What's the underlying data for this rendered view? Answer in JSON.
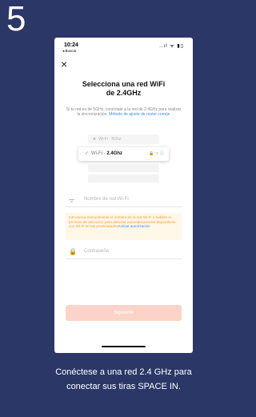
{
  "step_number": "5",
  "phone": {
    "status": {
      "time": "10:24",
      "back_label": "◂ Buscar",
      "icons": "..ıl ᯤ ▮▯"
    },
    "close_icon": "×",
    "title_line1": "Selecciona una red WiFi",
    "title_line2": "de 2.4GHz",
    "subtitle": "Si tu red es de 5GHz, conéctate a la red de 2.4GHz para realizar la sincronización.",
    "subtitle_link": "Método de ajuste de router común",
    "wifi_5g": {
      "prefix": "Wi-Fi - ",
      "band": "5Ghz"
    },
    "wifi_24": {
      "prefix": "Wi-Fi - ",
      "band": "2.4Ghz"
    },
    "network_placeholder": "Nombre de red Wi-Fi",
    "warning_text": "Introduzca manualmente el nombre de la red Wi-Fi o habilite el permiso de ubicación para detectar automáticamente dispositivos con Wi-Fi en las proximidades",
    "warning_link": "Activar autorización",
    "password_placeholder": "Contraseña",
    "next_button": "Siguiente"
  },
  "caption_line1": "Conéctese a una red 2.4 GHz para",
  "caption_line2": "conectar sus tiras SPACE IN."
}
